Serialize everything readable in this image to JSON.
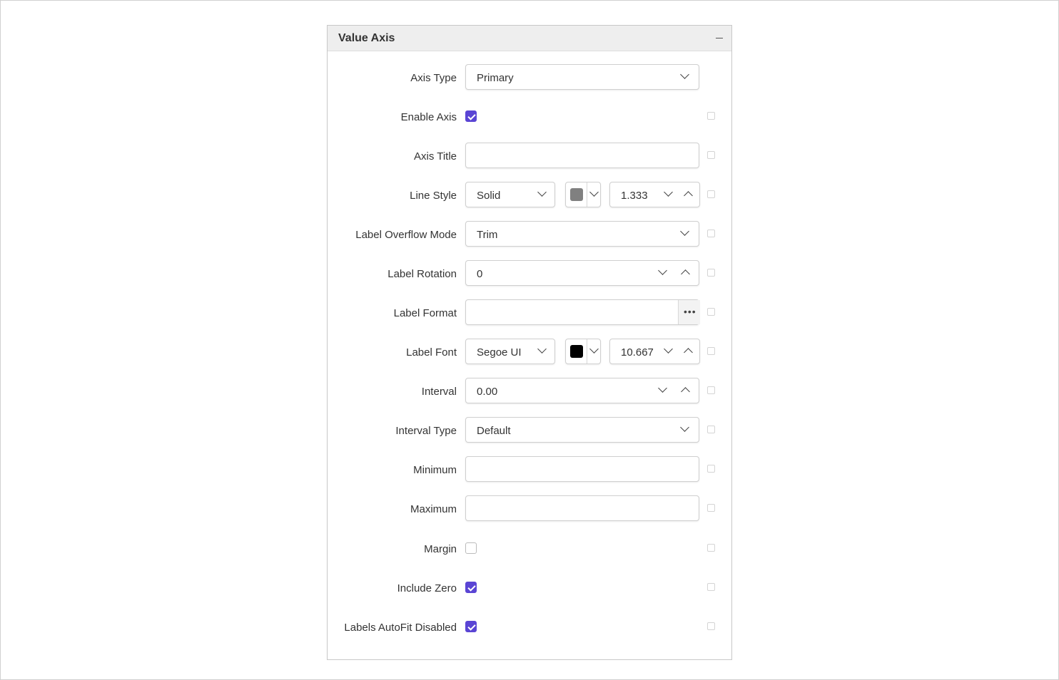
{
  "panel": {
    "title": "Value Axis"
  },
  "rows": {
    "axis_type": {
      "label": "Axis Type",
      "value": "Primary"
    },
    "enable_axis": {
      "label": "Enable Axis",
      "checked": true
    },
    "axis_title": {
      "label": "Axis Title",
      "value": ""
    },
    "line_style": {
      "label": "Line Style",
      "style": "Solid",
      "color": "#808080",
      "width": "1.333"
    },
    "label_overflow_mode": {
      "label": "Label Overflow Mode",
      "value": "Trim"
    },
    "label_rotation": {
      "label": "Label Rotation",
      "value": "0"
    },
    "label_format": {
      "label": "Label Format",
      "value": "",
      "ellipsis": "•••"
    },
    "label_font": {
      "label": "Label Font",
      "family": "Segoe UI",
      "color": "#000000",
      "size": "10.667"
    },
    "interval": {
      "label": "Interval",
      "value": "0.00"
    },
    "interval_type": {
      "label": "Interval Type",
      "value": "Default"
    },
    "minimum": {
      "label": "Minimum",
      "value": ""
    },
    "maximum": {
      "label": "Maximum",
      "value": ""
    },
    "margin": {
      "label": "Margin",
      "checked": false
    },
    "include_zero": {
      "label": "Include Zero",
      "checked": true
    },
    "labels_autofit_disabled": {
      "label": "Labels AutoFit Disabled",
      "checked": true
    }
  },
  "colors": {
    "accent": "#5a45d4",
    "header_bg": "#eeeeee"
  },
  "icons": [
    "minimize-icon",
    "chevron-down-icon",
    "chevron-up-icon",
    "check-icon",
    "ellipsis-icon"
  ]
}
